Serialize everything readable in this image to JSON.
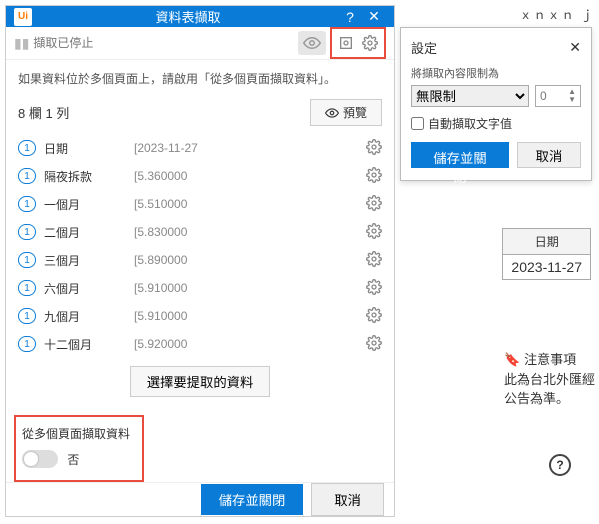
{
  "dialog": {
    "logo": "Ui",
    "title": "資料表擷取",
    "help": "?",
    "close": "✕",
    "search_placeholder": "擷取已停止",
    "hint": "如果資料位於多個頁面上，請啟用「從多個頁面擷取資料」。",
    "count": "8 欄 1 列",
    "preview": "預覽",
    "rows": [
      {
        "badge": "1",
        "label": "日期",
        "value": "[2023-11-27"
      },
      {
        "badge": "1",
        "label": "隔夜拆款",
        "value": "[5.360000"
      },
      {
        "badge": "1",
        "label": "一個月",
        "value": "[5.510000"
      },
      {
        "badge": "1",
        "label": "二個月",
        "value": "[5.830000"
      },
      {
        "badge": "1",
        "label": "三個月",
        "value": "[5.890000"
      },
      {
        "badge": "1",
        "label": "六個月",
        "value": "[5.910000"
      },
      {
        "badge": "1",
        "label": "九個月",
        "value": "[5.910000"
      },
      {
        "badge": "1",
        "label": "十二個月",
        "value": "[5.920000"
      }
    ],
    "select_data": "選擇要提取的資料",
    "multi_label": "從多個頁面擷取資料",
    "toggle_value": "否",
    "save_close": "儲存並關閉",
    "cancel": "取消"
  },
  "settings": {
    "title": "設定",
    "subtitle": "將擷取內容限制為",
    "option": "無限制",
    "number": "0",
    "auto_text": "自動擷取文字值",
    "save_close": "儲存並關閉",
    "cancel": "取消"
  },
  "bg": {
    "top_text": "ｘｎｘｎ ｊ",
    "date_header": "日期",
    "date_value": "2023-11-27",
    "note_title": "注意事項",
    "note_line1": "此為台北外匯經",
    "note_line2": "公告為準。",
    "help": "?"
  }
}
